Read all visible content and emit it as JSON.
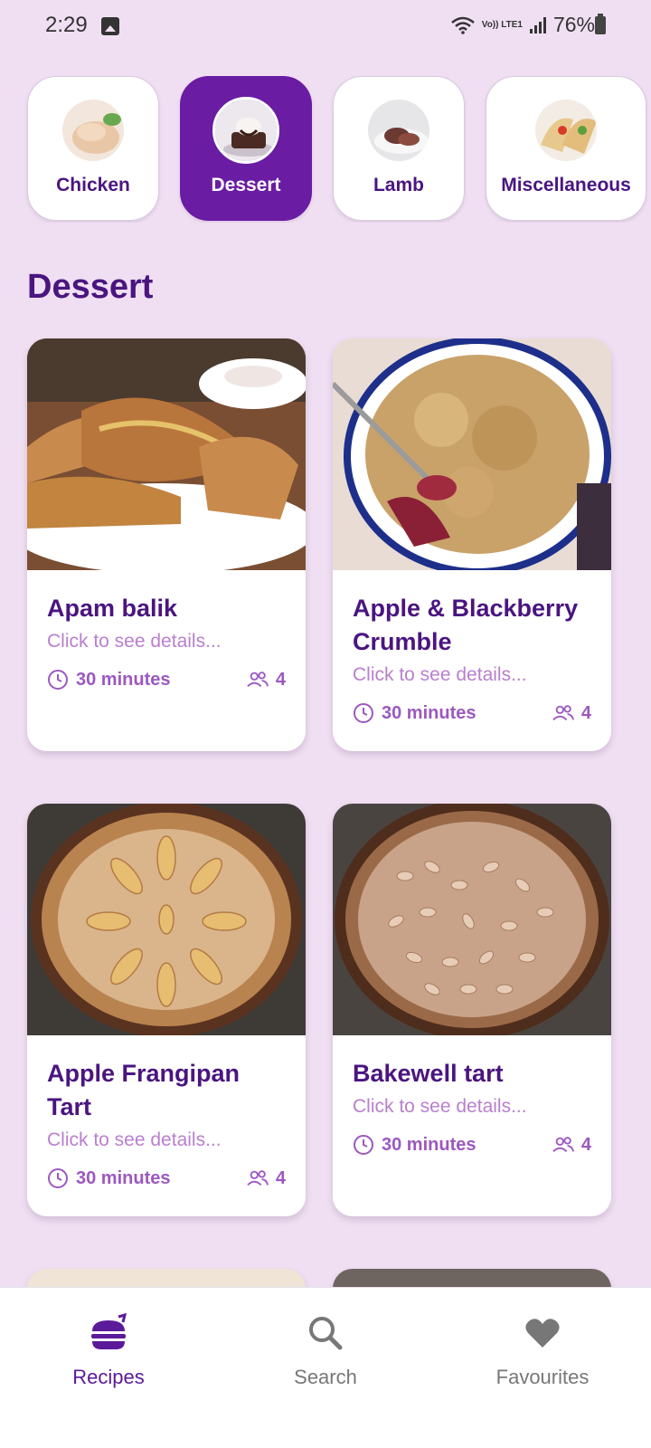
{
  "status_bar": {
    "time": "2:29",
    "lte": "Vo)) LTE1",
    "battery": "76%"
  },
  "categories": [
    {
      "label": "Chicken",
      "active": false,
      "icon": "chicken-dish"
    },
    {
      "label": "Dessert",
      "active": true,
      "icon": "dessert-dish"
    },
    {
      "label": "Lamb",
      "active": false,
      "icon": "lamb-dish"
    },
    {
      "label": "Miscellaneous",
      "active": false,
      "icon": "taco-dish"
    }
  ],
  "section_title": "Dessert",
  "recipes": [
    {
      "title": "Apam balik",
      "subtitle": "Click to see details...",
      "time": "30 minutes",
      "servings": "4"
    },
    {
      "title": "Apple & Blackberry Crumble",
      "subtitle": "Click to see details...",
      "time": "30 minutes",
      "servings": "4"
    },
    {
      "title": "Apple Frangipan Tart",
      "subtitle": "Click to see details...",
      "time": "30 minutes",
      "servings": "4"
    },
    {
      "title": "Bakewell tart",
      "subtitle": "Click to see details...",
      "time": "30 minutes",
      "servings": "4"
    }
  ],
  "bottom_nav": [
    {
      "label": "Recipes",
      "icon": "burger-icon",
      "active": true
    },
    {
      "label": "Search",
      "icon": "search-icon",
      "active": false
    },
    {
      "label": "Favourites",
      "icon": "heart-icon",
      "active": false
    }
  ],
  "colors": {
    "background": "#f0dff2",
    "primary": "#6a1ca3",
    "title": "#4a1580",
    "subtitle": "#b97fcf"
  }
}
